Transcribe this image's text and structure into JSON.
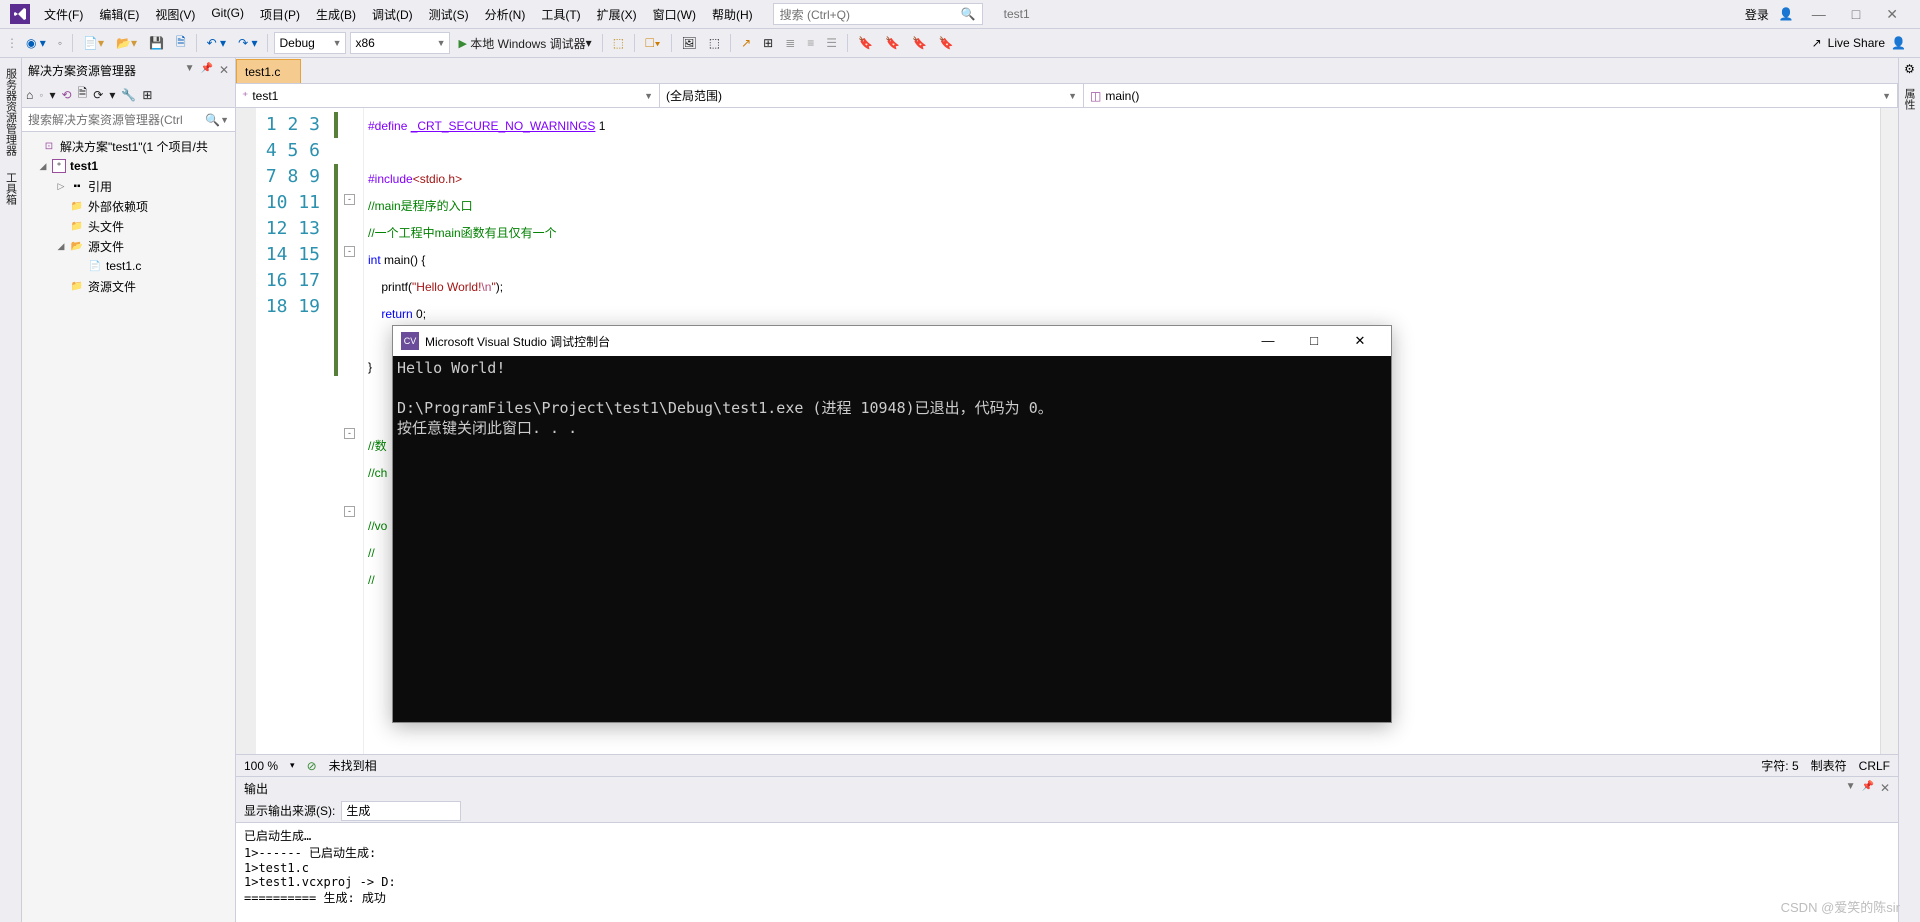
{
  "menu": {
    "items": [
      "文件(F)",
      "编辑(E)",
      "视图(V)",
      "Git(G)",
      "项目(P)",
      "生成(B)",
      "调试(D)",
      "测试(S)",
      "分析(N)",
      "工具(T)",
      "扩展(X)",
      "窗口(W)",
      "帮助(H)"
    ],
    "search_placeholder": "搜索 (Ctrl+Q)",
    "project_name": "test1",
    "login": "登录",
    "win": {
      "min": "—",
      "max": "□",
      "close": "✕"
    }
  },
  "toolbar": {
    "config": "Debug",
    "platform": "x86",
    "run_label": "本地 Windows 调试器",
    "live_share": "Live Share"
  },
  "left_tabs": [
    "服务器资源管理器",
    "工具箱"
  ],
  "right_tabs": [
    "属性"
  ],
  "solution": {
    "title": "解决方案资源管理器",
    "search_placeholder": "搜索解决方案资源管理器(Ctrl",
    "root": "解决方案\"test1\"(1 个项目/共",
    "project": "test1",
    "nodes": {
      "refs": "引用",
      "ext": "外部依赖项",
      "headers": "头文件",
      "src": "源文件",
      "file": "test1.c",
      "res": "资源文件"
    }
  },
  "tabs": {
    "active": "test1.c"
  },
  "nav": {
    "scope1": "test1",
    "scope2": "(全局范围)",
    "scope3": "main()"
  },
  "code": {
    "lines": [
      "1",
      "2",
      "3",
      "4",
      "5",
      "6",
      "7",
      "8",
      "9",
      "10",
      "11",
      "12",
      "13",
      "14",
      "15",
      "16",
      "17",
      "18",
      "19"
    ],
    "l1_a": "#define ",
    "l1_b": "_CRT_SECURE_NO_WARNINGS",
    "l1_c": " 1",
    "l3_a": "#include",
    "l3_b": "<stdio.h>",
    "l4": "//main是程序的入口",
    "l5": "//一个工程中main函数有且仅有一个",
    "l6_a": "int",
    "l6_b": " main() {",
    "l7_a": "    printf(",
    "l7_b": "\"Hello World!",
    "l7_c": "\\n",
    "l7_d": "\"",
    "l7_e": ");",
    "l8_a": "    ",
    "l8_b": "return",
    "l8_c": " 0;",
    "l10": "}",
    "l13": "//数",
    "l14": "//ch",
    "l16": "//vo",
    "l17": "// ",
    "l18": "// "
  },
  "status": {
    "zoom": "100 %",
    "issues": "未找到相",
    "col": "字符: 5",
    "tabs": "制表符",
    "eol": "CRLF"
  },
  "output": {
    "title": "输出",
    "src_label": "显示输出来源(S):",
    "src_value": "生成",
    "lines": [
      "已启动生成…",
      "1>------ 已启动生成:",
      "1>test1.c",
      "1>test1.vcxproj -> D:",
      "========== 生成: 成功"
    ]
  },
  "console": {
    "title": "Microsoft Visual Studio 调试控制台",
    "body": "Hello World!\n\nD:\\ProgramFiles\\Project\\test1\\Debug\\test1.exe (进程 10948)已退出，代码为 0。\n按任意键关闭此窗口. . ."
  },
  "watermark": "CSDN @爱笑的陈sir"
}
